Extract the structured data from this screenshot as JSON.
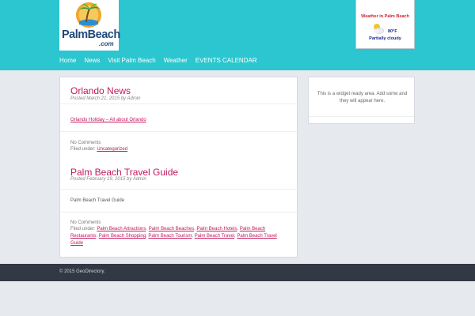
{
  "logo": {
    "text": "PalmBeach",
    "sub": ".com"
  },
  "weather": {
    "title": "Weather in Palm Beach",
    "temp": "80°F",
    "condition": "Partially cloudy"
  },
  "nav": [
    "Home",
    "News",
    "Visit Palm Beach",
    "Weather",
    "EVENTS CALENDAR"
  ],
  "posts": [
    {
      "title": "Orlando News",
      "meta": "Posted March 21, 2015 by Admin",
      "link": "Orlando Holiday – All about Orlando",
      "comments": "No Comments",
      "filed_label": "Filed under:",
      "categories": [
        "Uncategorized"
      ]
    },
    {
      "title": "Palm Beach Travel Guide",
      "meta": "Posted February 19, 2015 by Admin",
      "body": "Palm Beach Travel Guide",
      "comments": "No Comments",
      "filed_label": "Filed under:",
      "categories": [
        "Palm Beach Attractions",
        "Palm Beach Beaches",
        "Palm Beach Hotels",
        "Palm Beach Restaurants",
        "Palm Beach Shopping",
        "Palm Beach Tourism",
        "Palm Beach Travel",
        "Palm Beach Travel Guide"
      ]
    }
  ],
  "widget": {
    "text": "This is a widget ready area. Add some and they will appear here."
  },
  "footer": {
    "text": "© 2015 GeoDirectory."
  },
  "colors": {
    "header": "#2bc6cf",
    "accent": "#c2185b",
    "footer": "#323844",
    "page": "#e6e9ee"
  }
}
